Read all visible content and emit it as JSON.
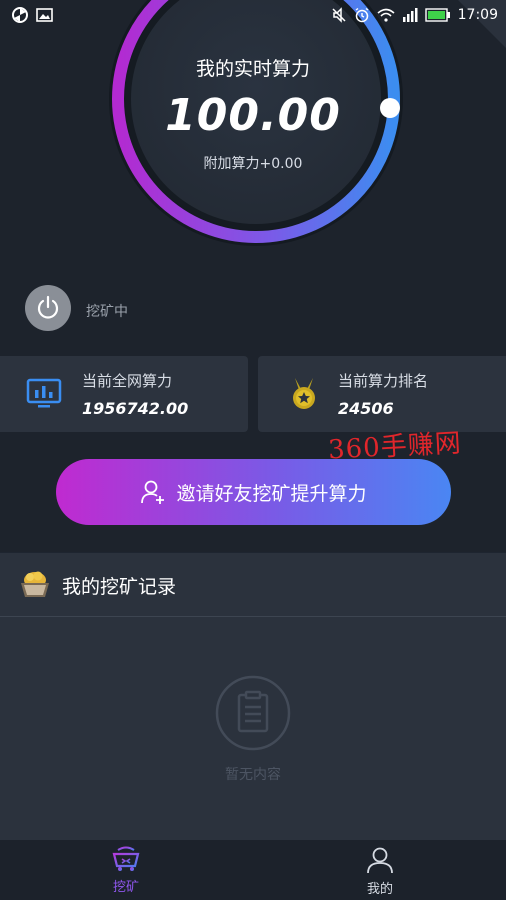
{
  "status_bar": {
    "time": "17:09",
    "left_icons": [
      "pinwheel-icon",
      "image-icon"
    ],
    "right_icons": [
      "mute-icon",
      "alarm-icon",
      "wifi-icon",
      "signal-icon",
      "battery-icon"
    ]
  },
  "gauge": {
    "title": "我的实时算力",
    "value": "100.00",
    "subtitle": "附加算力+0.00",
    "colors": {
      "start": "#b32ad1",
      "mid": "#7b5ae8",
      "end": "#3c8df0"
    }
  },
  "mining": {
    "status_label": "挖矿中",
    "icon": "power-icon"
  },
  "stats": {
    "network": {
      "label": "当前全网算力",
      "value": "1956742.00",
      "icon": "monitor-chart-icon"
    },
    "rank": {
      "label": "当前算力排名",
      "value": "24506",
      "icon": "medal-icon"
    }
  },
  "watermark": "360手赚网",
  "invite": {
    "label": "邀请好友挖矿提升算力",
    "icon": "add-user-icon",
    "gradient": [
      "#c02ad0",
      "#7a5ae6",
      "#4a86f3"
    ]
  },
  "records": {
    "title": "我的挖矿记录",
    "icon": "gold-cart-icon",
    "empty_text": "暂无内容",
    "empty_icon": "clipboard-icon"
  },
  "nav": {
    "items": [
      {
        "label": "挖矿",
        "icon": "mining-cart-icon",
        "active": true
      },
      {
        "label": "我的",
        "icon": "user-icon",
        "active": false
      }
    ],
    "active_color": "#8f57ee"
  }
}
